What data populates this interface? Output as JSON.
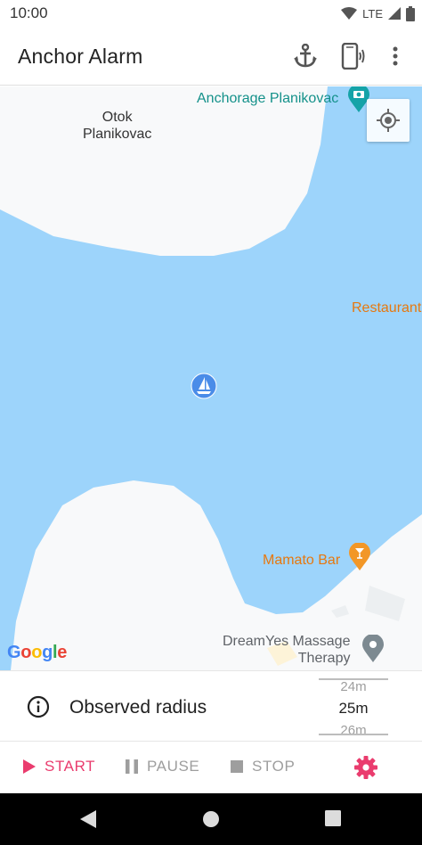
{
  "status_bar": {
    "time": "10:00",
    "network": "LTE",
    "icons": [
      "wifi-icon",
      "cellular-signal-icon",
      "battery-icon"
    ]
  },
  "app_bar": {
    "title": "Anchor Alarm",
    "actions": [
      "anchor-icon",
      "phone-vibrate-icon",
      "more-vert-icon"
    ]
  },
  "map": {
    "labels": {
      "island": "Otok\nPlanikovac",
      "anchorage": "Anchorage Planikovac",
      "restaurant": "Restaurant",
      "bar": "Mamato Bar",
      "massage": "DreamYes Massage\nTherapy"
    },
    "attribution": "Google",
    "icons": [
      "my-location-icon",
      "sailboat-marker-icon"
    ]
  },
  "radius": {
    "label": "Observed radius",
    "picker": {
      "previous": "24m",
      "selected": "25m",
      "next": "26m"
    }
  },
  "actions": {
    "start": "START",
    "pause": "PAUSE",
    "stop": "STOP"
  },
  "colors": {
    "accent": "#ea3c6e",
    "water": "#9dd4fb",
    "land": "#f8f9fa",
    "marker_blue": "#4a8ce8",
    "poi_orange": "#f29727",
    "poi_teal": "#15a3a8"
  }
}
